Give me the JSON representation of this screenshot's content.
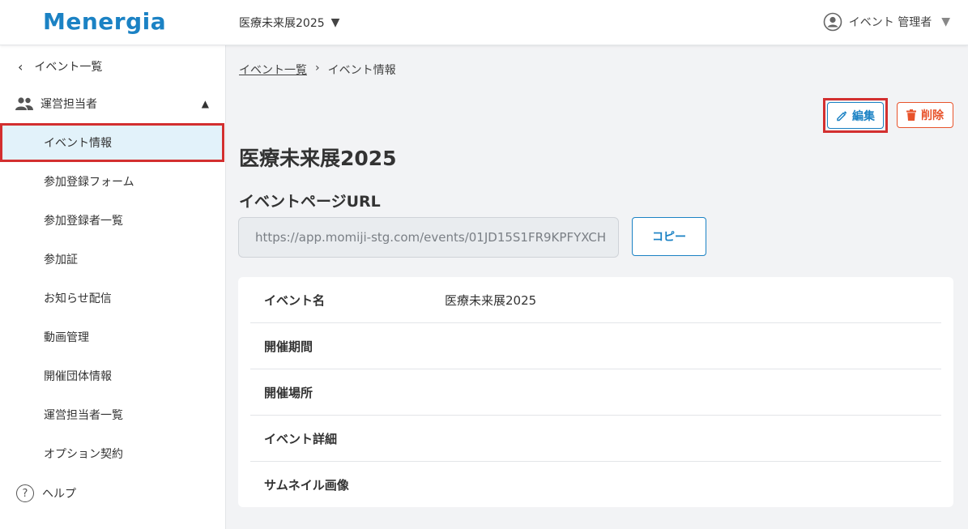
{
  "header": {
    "logo": "Menergia",
    "event_selector": "医療未来展2025",
    "user_name": "イベント 管理者"
  },
  "sidebar": {
    "back_label": "イベント一覧",
    "group_label": "運営担当者",
    "items": [
      {
        "label": "イベント情報",
        "active": true
      },
      {
        "label": "参加登録フォーム"
      },
      {
        "label": "参加登録者一覧"
      },
      {
        "label": "参加証"
      },
      {
        "label": "お知らせ配信"
      },
      {
        "label": "動画管理"
      },
      {
        "label": "開催団体情報"
      },
      {
        "label": "運営担当者一覧"
      },
      {
        "label": "オプション契約"
      }
    ],
    "help_label": "ヘルプ"
  },
  "main": {
    "breadcrumb": [
      "イベント一覧",
      "イベント情報"
    ],
    "edit_label": "編集",
    "delete_label": "削除",
    "title": "医療未来展2025",
    "url_label": "イベントページURL",
    "url_value": "https://app.momiji-stg.com/events/01JD15S1FR9KPFYXCH",
    "copy_label": "コピー",
    "details": [
      {
        "key": "イベント名",
        "value": "医療未来展2025"
      },
      {
        "key": "開催期間",
        "value": ""
      },
      {
        "key": "開催場所",
        "value": ""
      },
      {
        "key": "イベント詳細",
        "value": ""
      },
      {
        "key": "サムネイル画像",
        "value": ""
      }
    ]
  },
  "colors": {
    "brand": "#1b82c4",
    "danger": "#e8532b",
    "highlight": "#d32f2f",
    "active_bg": "#e2f2fa"
  }
}
